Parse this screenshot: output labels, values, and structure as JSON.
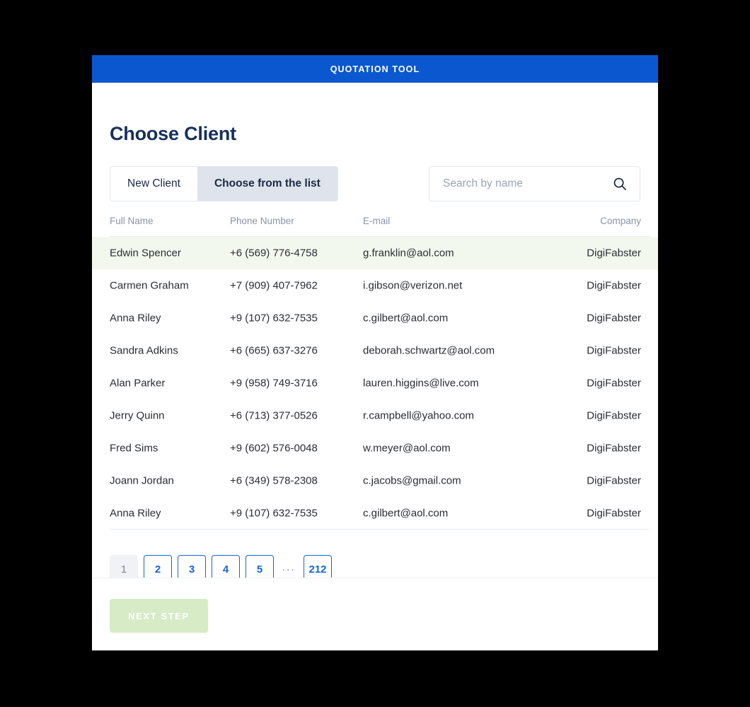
{
  "window": {
    "titlebar_text": "QUOTATION TOOL",
    "titlebar_color": "#0B57D0"
  },
  "page": {
    "title": "Choose Client"
  },
  "tabs": [
    {
      "label": "New Client",
      "active": false
    },
    {
      "label": "Choose from the list",
      "active": true
    }
  ],
  "search": {
    "placeholder": "Search by name",
    "value": "",
    "icon": "search-icon"
  },
  "table": {
    "columns": [
      "Full Name",
      "Phone Number",
      "E-mail",
      "Company"
    ],
    "rows": [
      {
        "name": "Edwin Spencer",
        "phone": "+6 (569) 776-4758",
        "email": "g.franklin@aol.com",
        "company": "DigiFabster",
        "highlighted": true
      },
      {
        "name": "Carmen Graham",
        "phone": "+7 (909) 407-7962",
        "email": "i.gibson@verizon.net",
        "company": "DigiFabster",
        "highlighted": false
      },
      {
        "name": "Anna Riley",
        "phone": "+9 (107) 632-7535",
        "email": "c.gilbert@aol.com",
        "company": "DigiFabster",
        "highlighted": false
      },
      {
        "name": "Sandra Adkins",
        "phone": "+6 (665) 637-3276",
        "email": "deborah.schwartz@aol.com",
        "company": "DigiFabster",
        "highlighted": false
      },
      {
        "name": "Alan Parker",
        "phone": "+9 (958) 749-3716",
        "email": "lauren.higgins@live.com",
        "company": "DigiFabster",
        "highlighted": false
      },
      {
        "name": "Jerry Quinn",
        "phone": "+6 (713) 377-0526",
        "email": "r.campbell@yahoo.com",
        "company": "DigiFabster",
        "highlighted": false
      },
      {
        "name": "Fred Sims",
        "phone": "+9 (602) 576-0048",
        "email": "w.meyer@aol.com",
        "company": "DigiFabster",
        "highlighted": false
      },
      {
        "name": "Joann Jordan",
        "phone": "+6 (349) 578-2308",
        "email": "c.jacobs@gmail.com",
        "company": "DigiFabster",
        "highlighted": false
      },
      {
        "name": "Anna Riley",
        "phone": "+9 (107) 632-7535",
        "email": "c.gilbert@aol.com",
        "company": "DigiFabster",
        "highlighted": false
      }
    ]
  },
  "pagination": {
    "pages": [
      "1",
      "2",
      "3",
      "4",
      "5"
    ],
    "ellipsis": "···",
    "last_page": "212",
    "current_page": "1"
  },
  "footer": {
    "next_step_label": "NEXT STEP",
    "next_step_enabled": false
  },
  "colors": {
    "brand_blue": "#0B57D0",
    "link_blue": "#1565D8",
    "title_navy": "#16305C",
    "row_highlight": "#F3F8EE",
    "next_step_bg": "#D7EBC6"
  }
}
